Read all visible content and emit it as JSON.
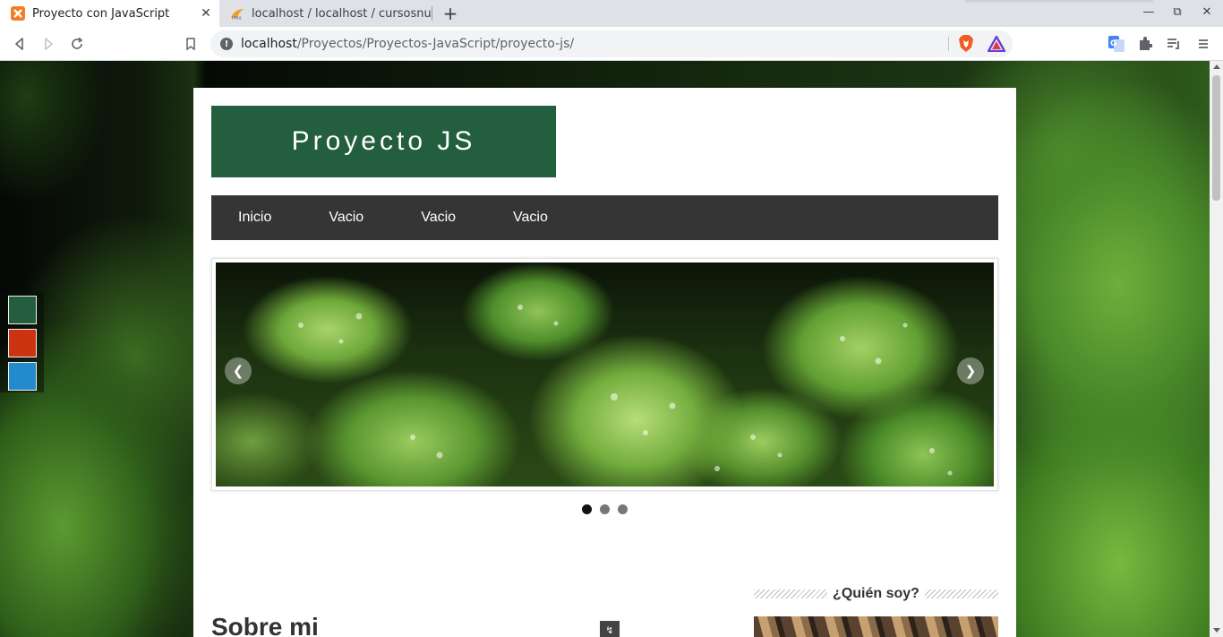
{
  "browser": {
    "tabs": [
      {
        "title": "Proyecto con JavaScript",
        "favicon": "xampp-icon",
        "active": true
      },
      {
        "title": "localhost / localhost / cursosnu",
        "favicon": "phpmyadmin-icon",
        "active": false
      }
    ],
    "url_host": "localhost",
    "url_path": "/Proyectos/Proyectos-JavaScript/proyecto-js/"
  },
  "page": {
    "logo": "Proyecto JS",
    "menu": [
      "Inicio",
      "Vacio",
      "Vacio",
      "Vacio"
    ],
    "theme_colors": [
      "#235e3f",
      "#cc3311",
      "#238acc"
    ],
    "slider": {
      "slide_count": 3,
      "active_slide": 1
    },
    "about": {
      "title": "Sobre mi"
    },
    "sidebar": {
      "title": "¿Quién soy?"
    }
  },
  "colors": {
    "brand_green": "#235e3f",
    "menu_bg": "#353535"
  }
}
